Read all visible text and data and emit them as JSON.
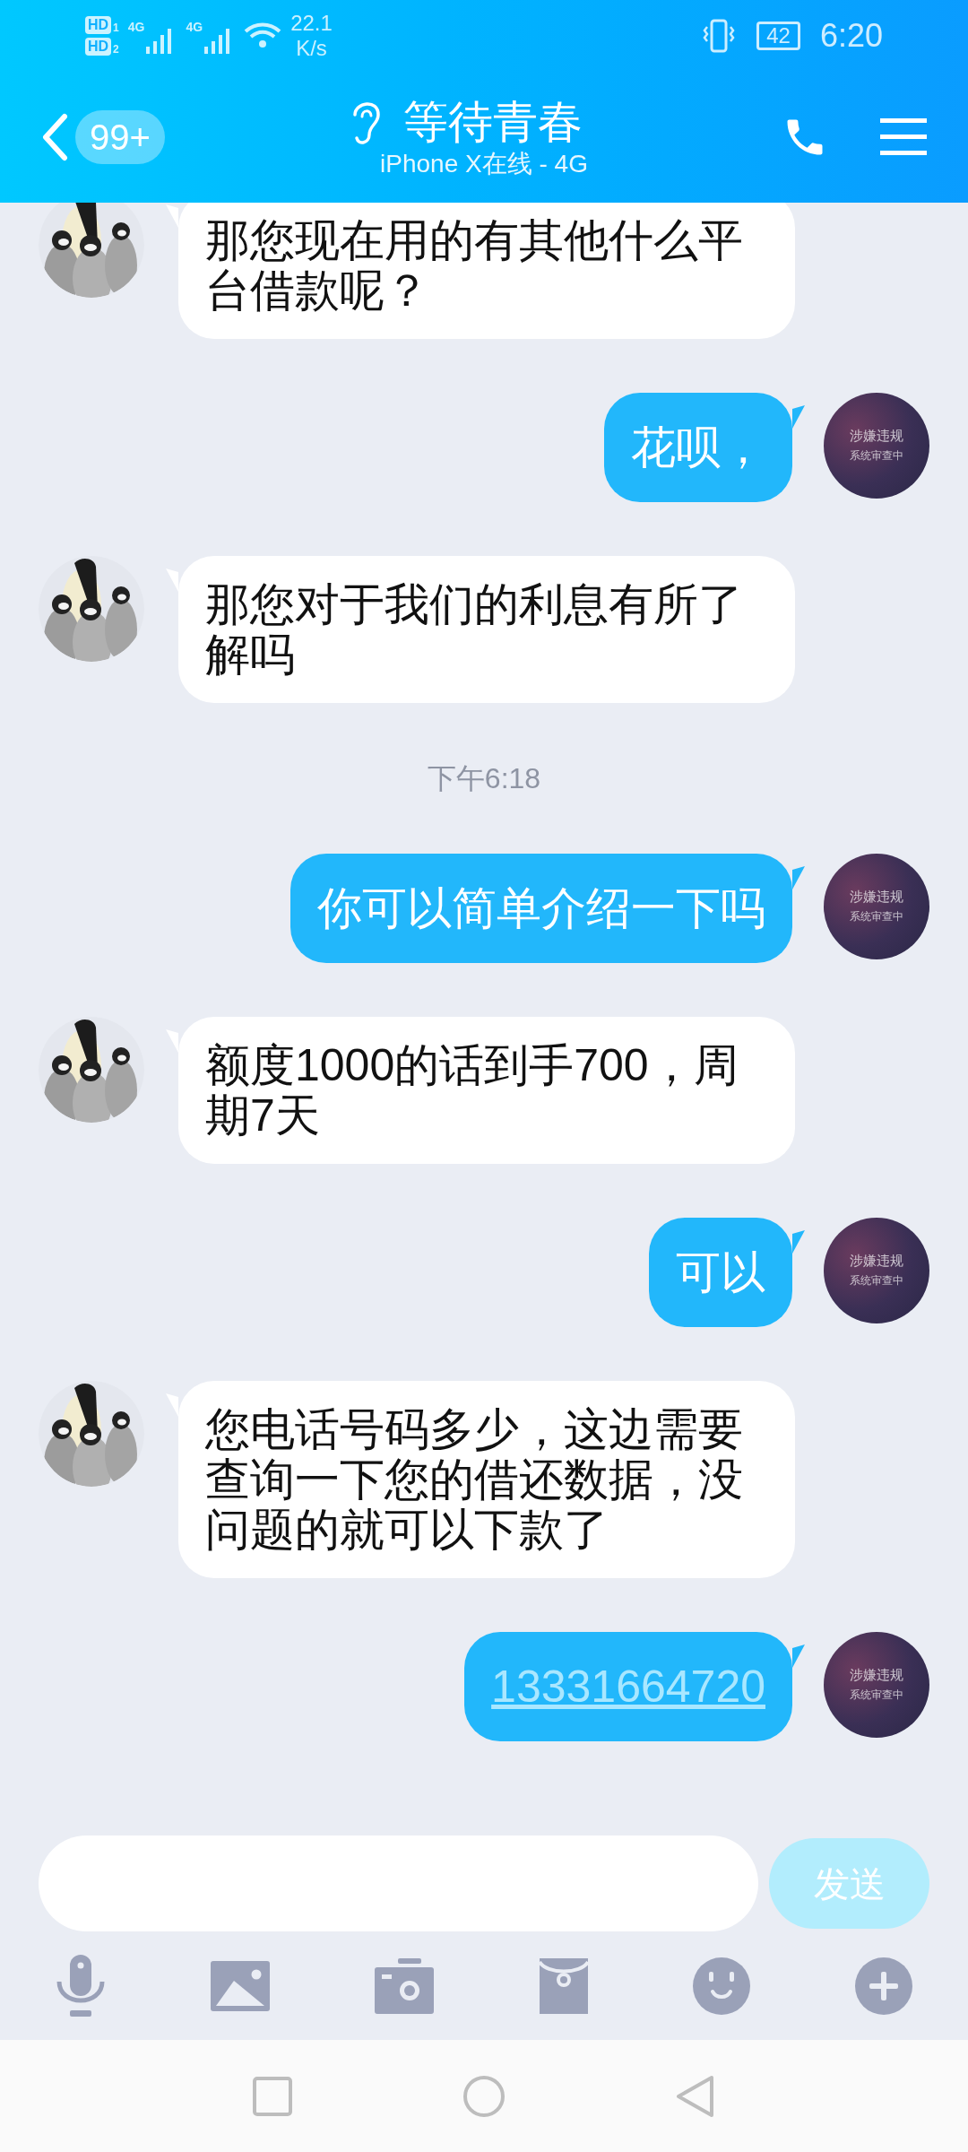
{
  "status_bar": {
    "sim_slots": [
      {
        "label": "HD",
        "slot": "1"
      },
      {
        "label": "HD",
        "slot": "2"
      }
    ],
    "signals": [
      {
        "label": "4G"
      },
      {
        "label": "4G"
      }
    ],
    "network_speed": "22.1",
    "network_speed_unit": "K/s",
    "battery": "42",
    "time": "6:20"
  },
  "header": {
    "back_badge": "99+",
    "title": "等待青春",
    "subtitle": "iPhone X在线 - 4G"
  },
  "messages": [
    {
      "kind": "received",
      "text": "那您现在用的有其他什么平台借款呢？"
    },
    {
      "kind": "sent",
      "text": "花呗，",
      "link": false,
      "avatar_label": [
        "涉嫌违规",
        "系统审查中"
      ]
    },
    {
      "kind": "received",
      "text": "那您对于我们的利息有所了解吗"
    },
    {
      "kind": "timestamp",
      "text": "下午6:18"
    },
    {
      "kind": "sent",
      "text": "你可以简单介绍一下吗",
      "link": false,
      "avatar_label": [
        "涉嫌违规",
        "系统审查中"
      ]
    },
    {
      "kind": "received",
      "text": "额度1000的话到手700，周期7天"
    },
    {
      "kind": "sent",
      "text": "可以",
      "link": false,
      "avatar_label": [
        "涉嫌违规",
        "系统审查中"
      ]
    },
    {
      "kind": "received",
      "text": "您电话号码多少，这边需要查询一下您的借还数据，没问题的就可以下款了"
    },
    {
      "kind": "sent",
      "text": "13331664720",
      "link": true,
      "avatar_label": [
        "涉嫌违规",
        "系统审查中"
      ]
    }
  ],
  "composer": {
    "send_button": "发送"
  }
}
